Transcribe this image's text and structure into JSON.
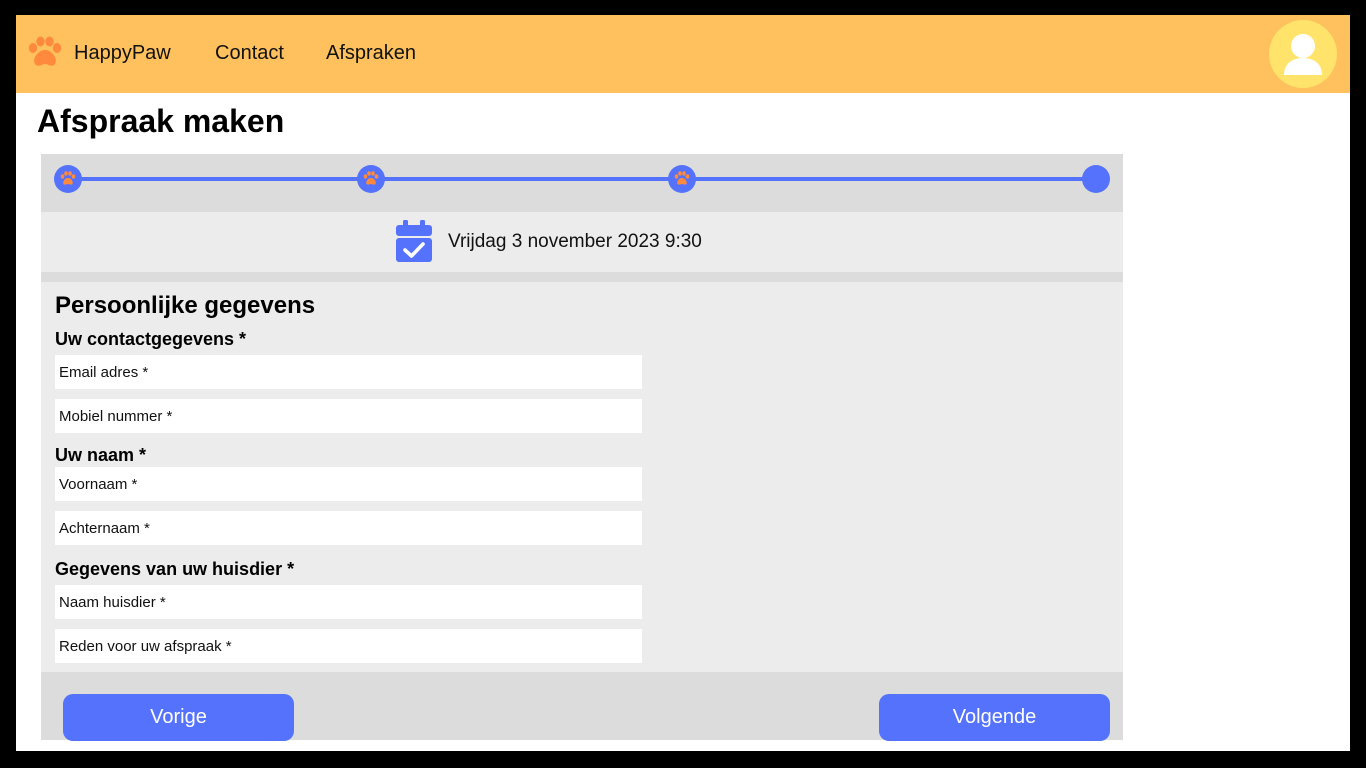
{
  "header": {
    "brand": "HappyPaw",
    "nav": [
      "Contact",
      "Afspraken"
    ]
  },
  "page_title": "Afspraak maken",
  "stepper": {
    "steps_total": 4,
    "current_step": 4,
    "line_color": "#5472fb",
    "paw_color": "#ff8a3d"
  },
  "appointment": {
    "datetime": "Vrijdag 3 november 2023 9:30"
  },
  "form": {
    "title": "Persoonlijke gegevens",
    "sections": {
      "contact": {
        "label": "Uw contactgegevens *",
        "email_placeholder": "Email adres *",
        "mobile_placeholder": "Mobiel nummer *"
      },
      "name": {
        "label": "Uw naam *",
        "firstname_placeholder": "Voornaam *",
        "lastname_placeholder": "Achternaam *"
      },
      "pet": {
        "label": "Gegevens van uw huisdier *",
        "petname_placeholder": "Naam huisdier *",
        "reason_placeholder": "Reden voor uw afspraak *"
      }
    }
  },
  "buttons": {
    "prev": "Vorige",
    "next": "Volgende"
  },
  "colors": {
    "navbar": "#ffc15e",
    "accent": "#5472fb",
    "avatar_bg": "#ffe36b",
    "paw_orange": "#ff8a3d"
  },
  "icons": [
    "paw-icon",
    "user-avatar-icon",
    "calendar-check-icon"
  ]
}
